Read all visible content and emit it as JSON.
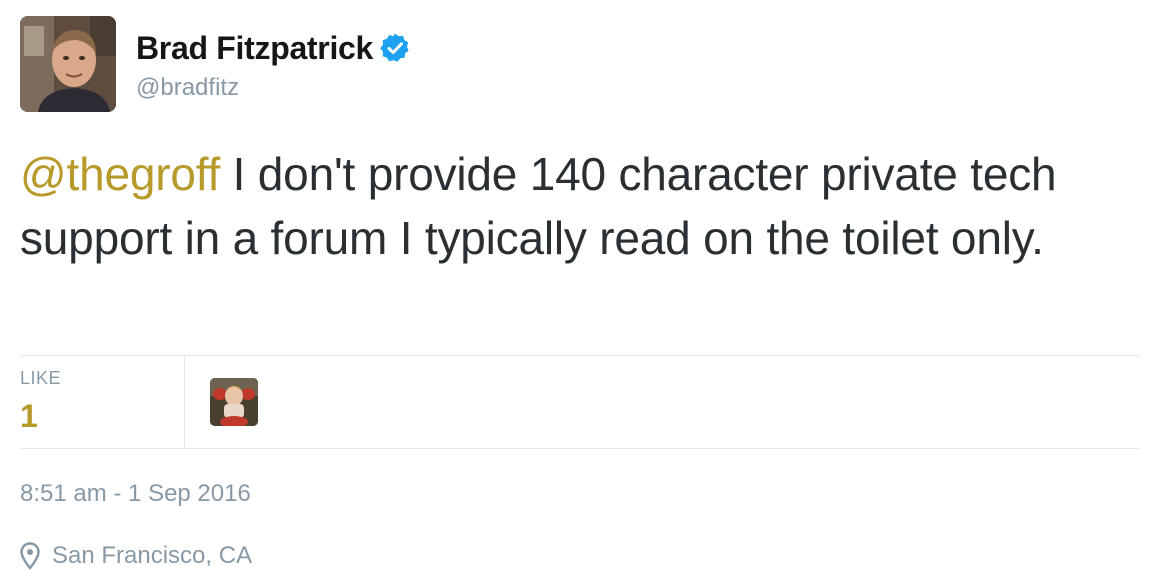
{
  "author": {
    "display_name": "Brad Fitzpatrick",
    "handle": "@bradfitz",
    "verified": true,
    "avatar_icon": "profile-photo"
  },
  "tweet": {
    "mention": "@thegroff",
    "text": " I don't provide 140 character private tech support in a forum I typically read on the toilet only."
  },
  "stats": {
    "like_label": "LIKE",
    "like_count": "1",
    "liker_avatar_icon": "profile-photo"
  },
  "meta": {
    "timestamp": "8:51 am - 1 Sep 2016",
    "location": "San Francisco, CA",
    "location_icon": "map-pin-icon"
  },
  "colors": {
    "accent": "#b89a2b",
    "text": "#292f33",
    "muted": "#8899a6",
    "divider": "#e1e8ed",
    "verified": "#1da1f2"
  }
}
